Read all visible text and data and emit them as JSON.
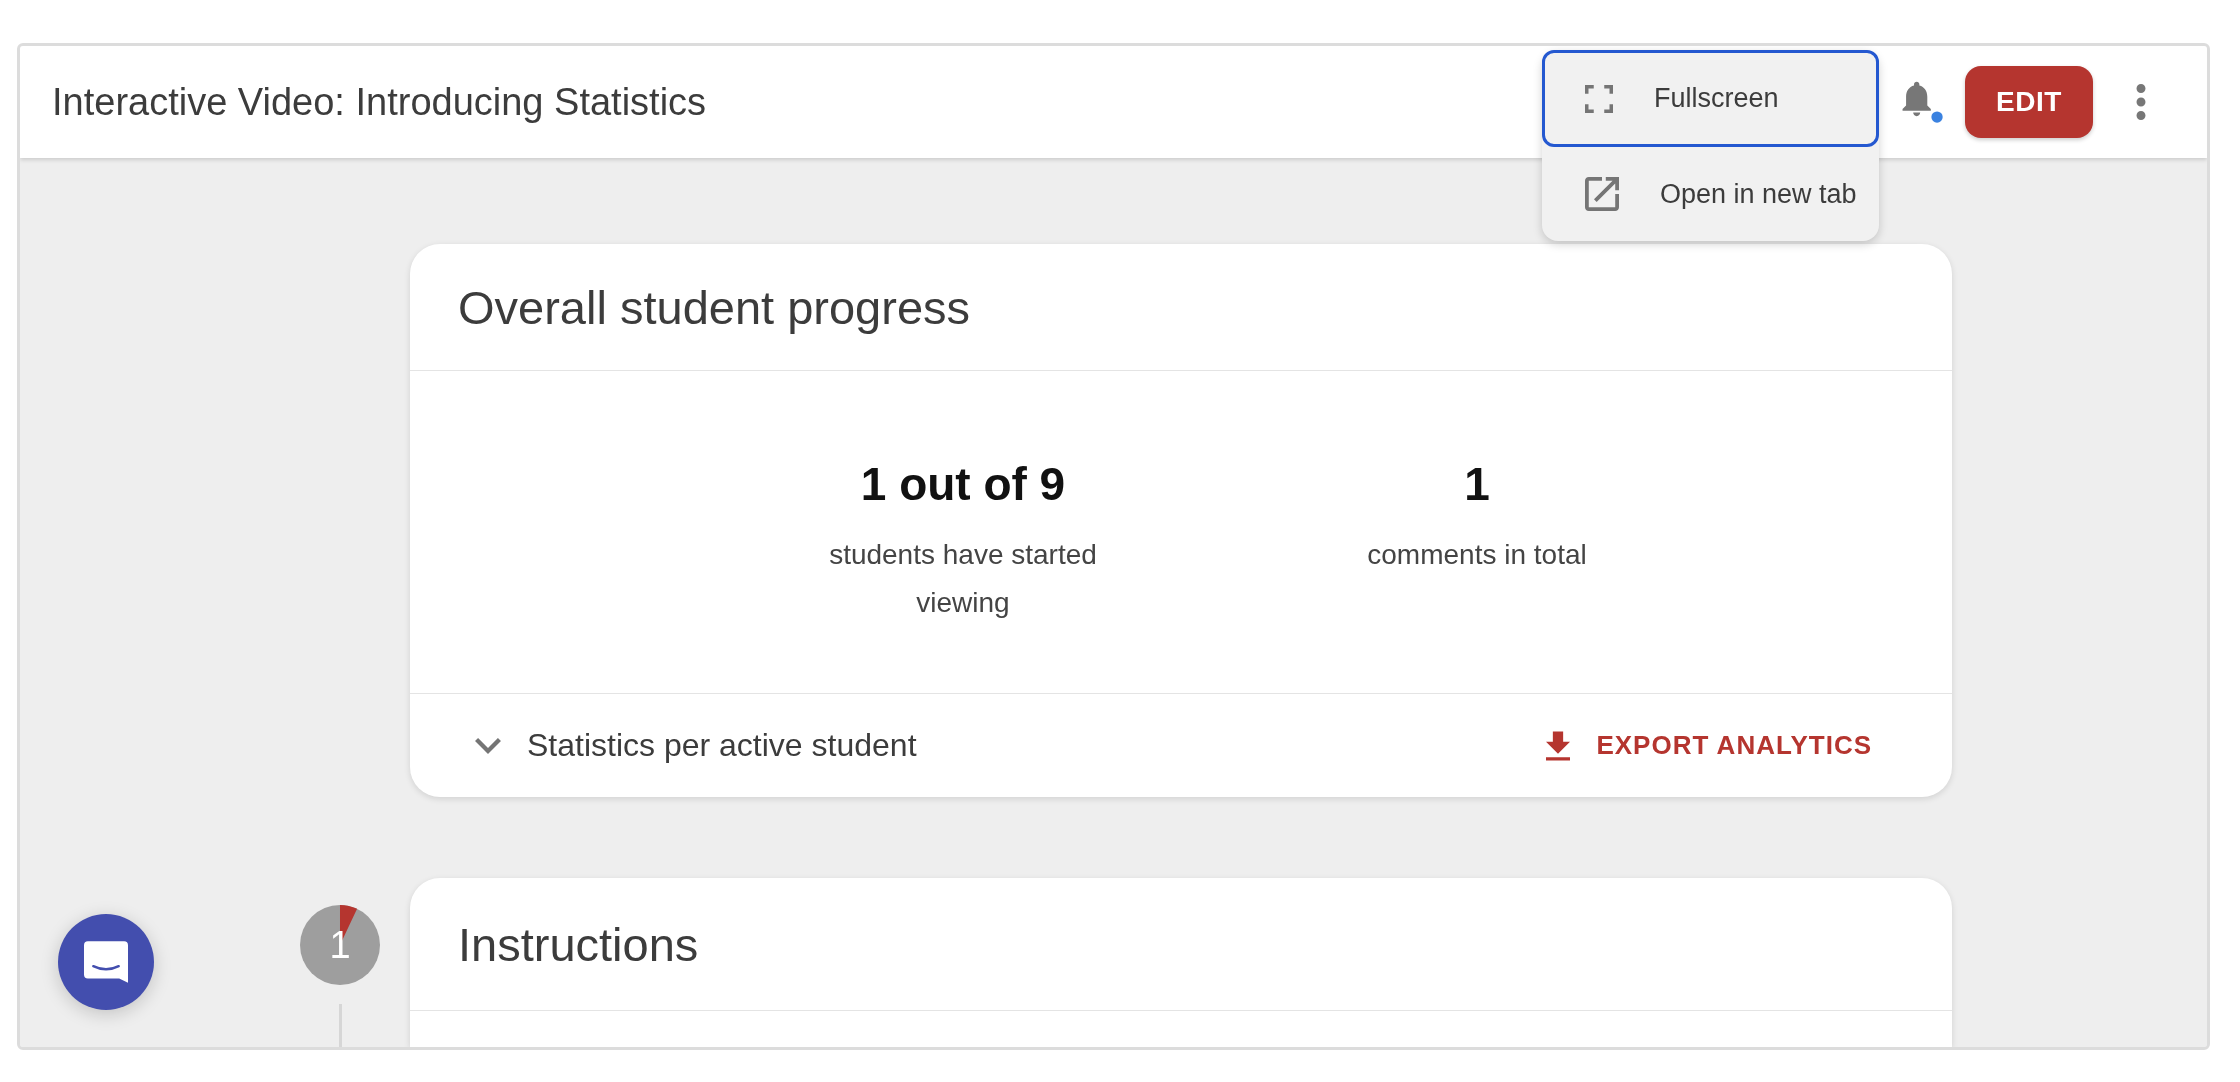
{
  "header": {
    "title": "Interactive Video: Introducing Statistics",
    "has_unread": true,
    "edit_label": "EDIT"
  },
  "menu": {
    "items": [
      {
        "kind": "fullscreen",
        "label": "Fullscreen",
        "focused": true
      },
      {
        "kind": "new-tab",
        "label": "Open in new tab",
        "focused": false
      }
    ]
  },
  "progress_card": {
    "title": "Overall student progress",
    "stats": [
      {
        "value": "1 out of 9",
        "label": "students have started viewing"
      },
      {
        "value": "1",
        "label": "comments in total"
      }
    ],
    "details_toggle": {
      "label": "Statistics per active student",
      "expanded": false
    },
    "export_label": "EXPORT ANALYTICS"
  },
  "steps": [
    {
      "number": "1",
      "level": 0.07,
      "title": "Instructions"
    }
  ]
}
